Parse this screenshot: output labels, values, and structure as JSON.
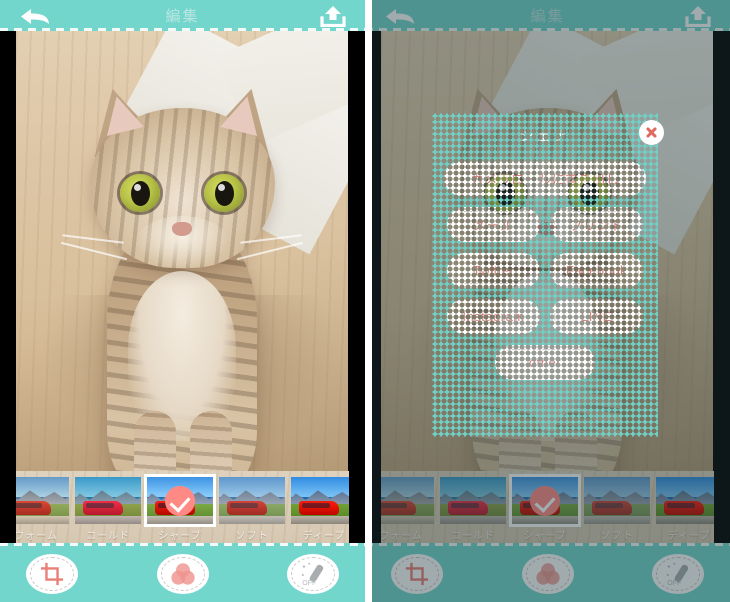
{
  "app": {
    "header": {
      "title": "編集",
      "back_icon": "back-arrow-icon",
      "upload_icon": "upload-icon"
    },
    "filters": {
      "items": [
        {
          "label": "ウォーム",
          "selected": false
        },
        {
          "label": "コールド",
          "selected": false
        },
        {
          "label": "シャープ",
          "selected": true
        },
        {
          "label": "ソフト",
          "selected": false
        },
        {
          "label": "ディープ",
          "selected": false
        }
      ],
      "selected_index": 2,
      "check_icon": "check-icon"
    },
    "toolbar": {
      "crop": {
        "icon": "crop-icon",
        "label": ""
      },
      "filter": {
        "icon": "color-circles-icon",
        "label": ""
      },
      "wand": {
        "icon": "magic-wand-icon",
        "label": "OFF"
      }
    },
    "photo": {
      "alt": "cat-photo"
    }
  },
  "share_dialog": {
    "title": "シェア",
    "close_icon": "close-icon",
    "buttons": [
      {
        "label": "カメラロールに書き出し",
        "size": "wide"
      },
      {
        "label": "メール",
        "size": "half"
      },
      {
        "label": "プリント",
        "size": "half"
      },
      {
        "label": "Twitter",
        "size": "half"
      },
      {
        "label": "Facebook",
        "size": "half"
      },
      {
        "label": "Instagram",
        "size": "half"
      },
      {
        "label": "LINE",
        "size": "half"
      },
      {
        "label": "other",
        "size": "mid"
      }
    ]
  },
  "colors": {
    "teal": "#73d6cd",
    "dialog_teal": "#71cfc4",
    "pink": "#e68f8b",
    "button_text": "#d9837f",
    "header_title": "#b9e6e1"
  }
}
